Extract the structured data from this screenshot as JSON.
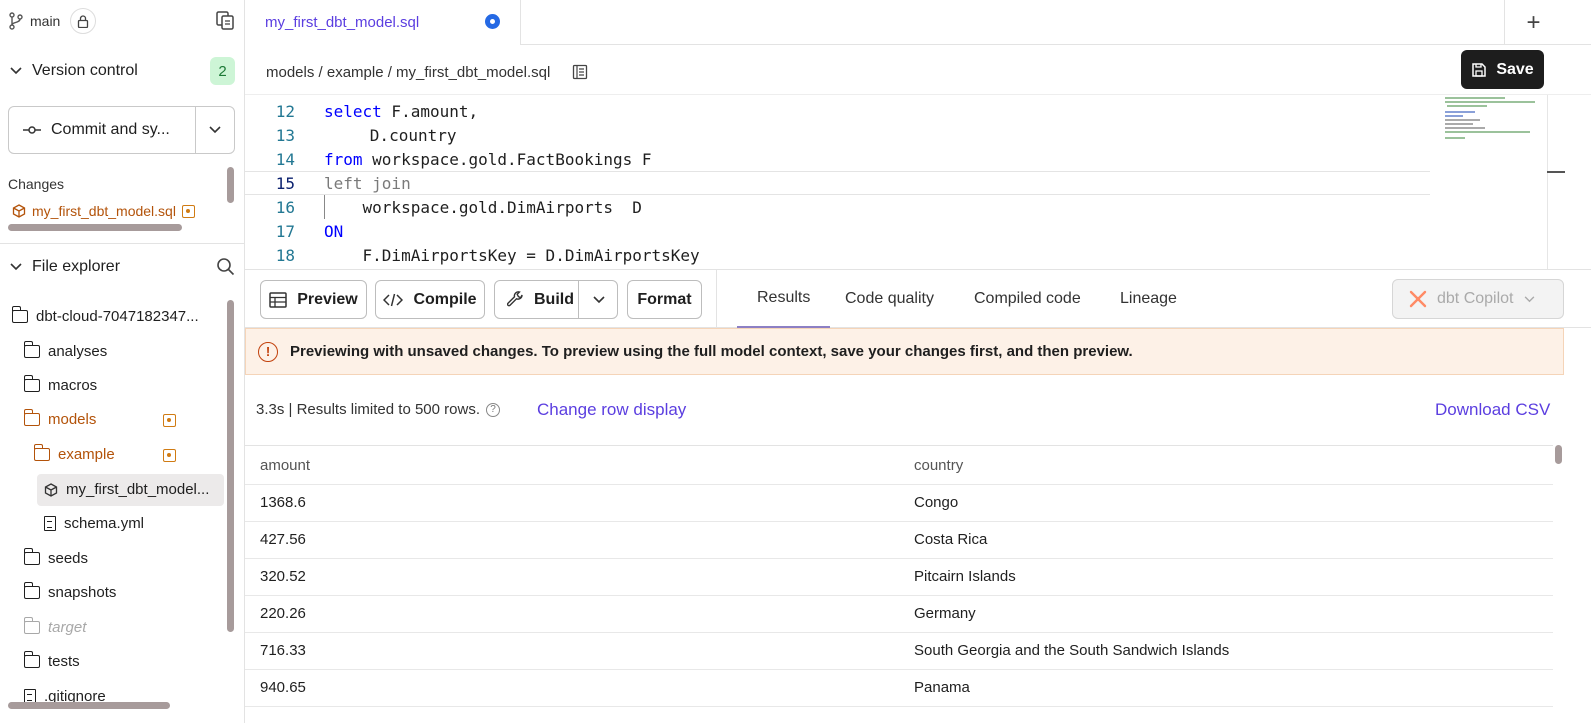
{
  "branch": {
    "name": "main"
  },
  "sidebar": {
    "version_control": {
      "label": "Version control",
      "count": "2"
    },
    "commit_button": {
      "label": "Commit and sy..."
    },
    "changes": {
      "label": "Changes",
      "files": [
        "my_first_dbt_model.sql"
      ]
    },
    "file_explorer": {
      "label": "File explorer",
      "root": "dbt-cloud-7047182347...",
      "items": [
        {
          "label": "analyses"
        },
        {
          "label": "macros"
        },
        {
          "label": "models"
        },
        {
          "label": "example"
        },
        {
          "label": "my_first_dbt_model..."
        },
        {
          "label": "schema.yml"
        },
        {
          "label": "seeds"
        },
        {
          "label": "snapshots"
        },
        {
          "label": "target"
        },
        {
          "label": "tests"
        },
        {
          "label": ".gitignore"
        }
      ]
    }
  },
  "tabs": {
    "active": "my_first_dbt_model.sql",
    "new_tab": "+"
  },
  "breadcrumb": {
    "path": "models / example / my_first_dbt_model.sql",
    "save_label": "Save"
  },
  "editor": {
    "lines": [
      {
        "num": "12",
        "kw": "select",
        "rest": " F.amount,"
      },
      {
        "num": "13",
        "kw": "",
        "rest": "      D.country"
      },
      {
        "num": "14",
        "kw": "from",
        "rest": " workspace.gold.FactBookings F"
      },
      {
        "num": "15",
        "kw": "",
        "rest": "left join"
      },
      {
        "num": "16",
        "kw": "",
        "rest": "    workspace.gold.DimAirports  D"
      },
      {
        "num": "17",
        "kw": "ON",
        "rest": ""
      },
      {
        "num": "18",
        "kw": "",
        "rest": "    F.DimAirportsKey = D.DimAirportsKey"
      }
    ]
  },
  "toolbar": {
    "preview": "Preview",
    "compile": "Compile",
    "build": "Build",
    "format": "Format",
    "tabs": [
      "Results",
      "Code quality",
      "Compiled code",
      "Lineage"
    ],
    "copilot": "dbt Copilot"
  },
  "warning": {
    "text": "Previewing with unsaved changes. To preview using the full model context, save your changes first, and then preview."
  },
  "results": {
    "info": "3.3s | Results limited to 500 rows.",
    "change_display": "Change row display",
    "download": "Download CSV",
    "columns": [
      "amount",
      "country"
    ],
    "rows": [
      [
        "1368.6",
        "Congo"
      ],
      [
        "427.56",
        "Costa Rica"
      ],
      [
        "320.52",
        "Pitcairn Islands"
      ],
      [
        "220.26",
        "Germany"
      ],
      [
        "716.33",
        "South Georgia and the South Sandwich Islands"
      ],
      [
        "940.65",
        "Panama"
      ]
    ]
  },
  "colors": {
    "accent": "#5b3ee0",
    "modified": "#b3530a",
    "warning_bg": "#fdf1e7",
    "keyword": "#0000ff"
  }
}
